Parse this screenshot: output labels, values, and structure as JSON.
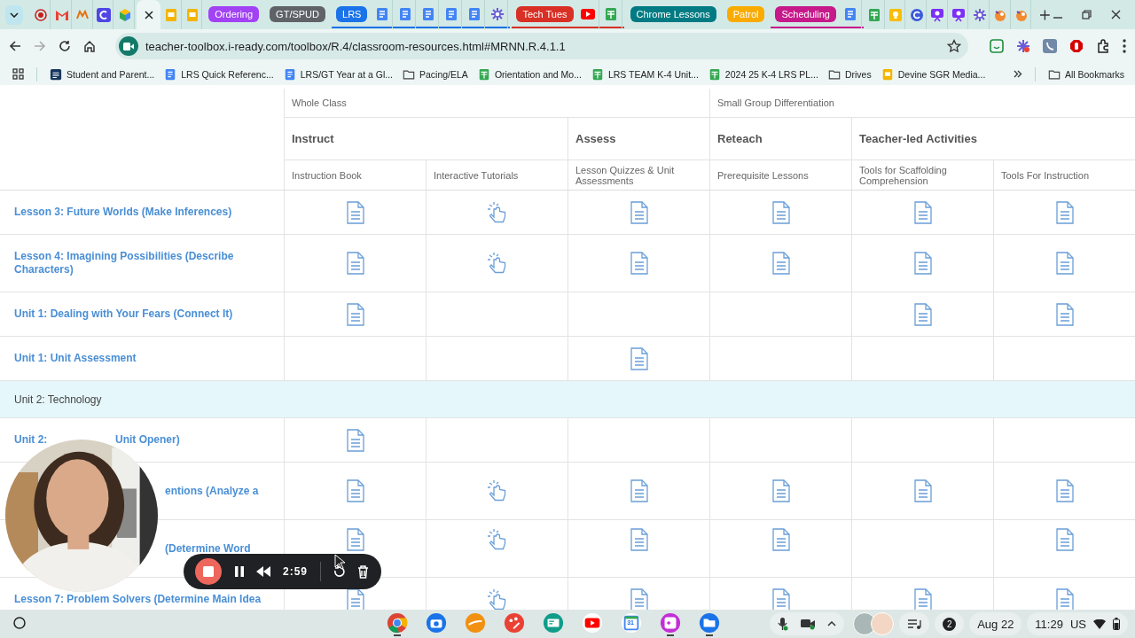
{
  "tab_strip": {
    "tabs": [
      {
        "kind": "site",
        "selected": false
      },
      {
        "kind": "site",
        "selected": false
      },
      {
        "kind": "site",
        "selected": false
      },
      {
        "kind": "site",
        "selected": false
      },
      {
        "kind": "site",
        "selected": false
      },
      {
        "kind": "site",
        "selected": true
      },
      {
        "kind": "site",
        "selected": false
      },
      {
        "kind": "site",
        "selected": false
      },
      {
        "kind": "group",
        "label": "Ordering",
        "color": "#a142f4",
        "expanded": false
      },
      {
        "kind": "group",
        "label": "GT/SPUD",
        "color": "#5f6368",
        "expanded": false
      },
      {
        "kind": "group",
        "label": "LRS",
        "color": "#1a73e8",
        "expanded": true,
        "children": [
          {
            "kind": "site",
            "selected": false
          },
          {
            "kind": "site",
            "selected": false
          },
          {
            "kind": "site",
            "selected": false
          },
          {
            "kind": "site",
            "selected": false
          },
          {
            "kind": "site",
            "selected": false
          },
          {
            "kind": "site",
            "selected": false
          }
        ]
      },
      {
        "kind": "group",
        "label": "Tech Tues",
        "color": "#d93025",
        "expanded": true,
        "children": [
          {
            "kind": "site",
            "selected": false
          },
          {
            "kind": "site",
            "selected": false
          }
        ]
      },
      {
        "kind": "group",
        "label": "Chrome Lessons",
        "color": "#007b83",
        "expanded": false
      },
      {
        "kind": "group",
        "label": "Patrol",
        "color": "#f9ab00",
        "expanded": false
      },
      {
        "kind": "group",
        "label": "Scheduling",
        "color": "#c61a8a",
        "expanded": true,
        "children": [
          {
            "kind": "site",
            "selected": false
          }
        ]
      },
      {
        "kind": "site",
        "selected": false
      },
      {
        "kind": "site",
        "selected": false
      },
      {
        "kind": "site",
        "selected": false
      },
      {
        "kind": "site",
        "selected": false
      },
      {
        "kind": "site",
        "selected": false
      },
      {
        "kind": "site",
        "selected": false
      },
      {
        "kind": "site",
        "selected": false
      },
      {
        "kind": "site",
        "selected": false
      }
    ]
  },
  "toolbar": {
    "url": "teacher-toolbox.i-ready.com/toolbox/R.4/classroom-resources.html#MRNN.R.4.1.1",
    "forward_disabled": true
  },
  "bookmarks": [
    {
      "kind": "sis",
      "label": "Student and Parent..."
    },
    {
      "kind": "doc",
      "label": "LRS Quick Referenc..."
    },
    {
      "kind": "doc",
      "label": "LRS/GT Year at a Gl..."
    },
    {
      "kind": "folder",
      "label": "Pacing/ELA"
    },
    {
      "kind": "sheet",
      "label": "Orientation and Mo..."
    },
    {
      "kind": "sheet",
      "label": "LRS TEAM K-4 Unit..."
    },
    {
      "kind": "sheet",
      "label": "2024 25 K-4 LRS PL..."
    },
    {
      "kind": "folder",
      "label": "Drives"
    },
    {
      "kind": "slides",
      "label": "Devine SGR Media..."
    }
  ],
  "all_bookmarks": "All Bookmarks",
  "table": {
    "groups": [
      "Whole Class",
      "Small Group Differentiation"
    ],
    "categories": [
      "Instruct",
      "Assess",
      "Reteach",
      "Teacher-led Activities"
    ],
    "columns": [
      "Instruction Book",
      "Interactive Tutorials",
      "Lesson Quizzes & Unit Assessments",
      "Prerequisite Lessons",
      "Tools for Scaffolding Comprehension",
      "Tools For Instruction"
    ],
    "rows": [
      {
        "kind": "lesson",
        "title_parts": [
          "Lesson 3: Future Worlds (Make Inferences)"
        ],
        "cells": [
          {
            "kind": "document"
          },
          {
            "kind": "tutorial"
          },
          {
            "kind": "document"
          },
          {
            "kind": "document"
          },
          {
            "kind": "document"
          },
          {
            "kind": "document"
          }
        ]
      },
      {
        "kind": "lesson",
        "title_parts": [
          "Lesson 4: Imagining Possibilities (Describe Characters)"
        ],
        "cells": [
          {
            "kind": "document"
          },
          {
            "kind": "tutorial"
          },
          {
            "kind": "document"
          },
          {
            "kind": "document"
          },
          {
            "kind": "document"
          },
          {
            "kind": "document"
          }
        ]
      },
      {
        "kind": "lesson",
        "title_parts": [
          "Unit 1: Dealing with Your Fears (Connect It)"
        ],
        "cells": [
          {
            "kind": "document"
          },
          {
            "kind": "empty"
          },
          {
            "kind": "empty"
          },
          {
            "kind": "empty"
          },
          {
            "kind": "document"
          },
          {
            "kind": "document"
          }
        ]
      },
      {
        "kind": "lesson",
        "title_parts": [
          "Unit 1: Unit Assessment"
        ],
        "cells": [
          {
            "kind": "empty"
          },
          {
            "kind": "empty"
          },
          {
            "kind": "document"
          },
          {
            "kind": "empty"
          },
          {
            "kind": "empty"
          },
          {
            "kind": "empty"
          }
        ]
      },
      {
        "kind": "section",
        "title_parts": [
          "Unit 2: Technology"
        ]
      },
      {
        "kind": "covered",
        "title_parts": [
          "Unit 2:",
          "Unit Opener)"
        ],
        "cells": [
          {
            "kind": "document"
          },
          {
            "kind": "empty"
          },
          {
            "kind": "empty"
          },
          {
            "kind": "empty"
          },
          {
            "kind": "empty"
          },
          {
            "kind": "empty"
          }
        ]
      },
      {
        "kind": "covered",
        "title_parts": [
          "entions (Analyze a"
        ],
        "cells": [
          {
            "kind": "document"
          },
          {
            "kind": "tutorial"
          },
          {
            "kind": "document"
          },
          {
            "kind": "document"
          },
          {
            "kind": "document"
          },
          {
            "kind": "document"
          }
        ]
      },
      {
        "kind": "covered",
        "title_parts": [
          "(Determine Word"
        ],
        "cells": [
          {
            "kind": "document"
          },
          {
            "kind": "tutorial"
          },
          {
            "kind": "document"
          },
          {
            "kind": "document"
          },
          {
            "kind": "empty"
          },
          {
            "kind": "document"
          }
        ]
      },
      {
        "kind": "lesson",
        "title_parts": [
          "Lesson 7: Problem Solvers (Determine Main Idea"
        ],
        "cells": [
          {
            "kind": "document"
          },
          {
            "kind": "tutorial"
          },
          {
            "kind": "document"
          },
          {
            "kind": "document"
          },
          {
            "kind": "document"
          },
          {
            "kind": "document"
          }
        ]
      }
    ]
  },
  "recorder": {
    "elapsed": "2:59"
  },
  "shelf": {
    "apps": [
      {
        "running": true
      },
      {
        "running": false
      },
      {
        "running": false
      },
      {
        "running": false
      },
      {
        "running": false
      },
      {
        "running": false
      },
      {
        "running": false,
        "label": "31"
      },
      {
        "running": true
      },
      {
        "running": true
      }
    ],
    "notifications": "2",
    "date": "Aug 22",
    "time": "11:29",
    "input_method": "US"
  }
}
